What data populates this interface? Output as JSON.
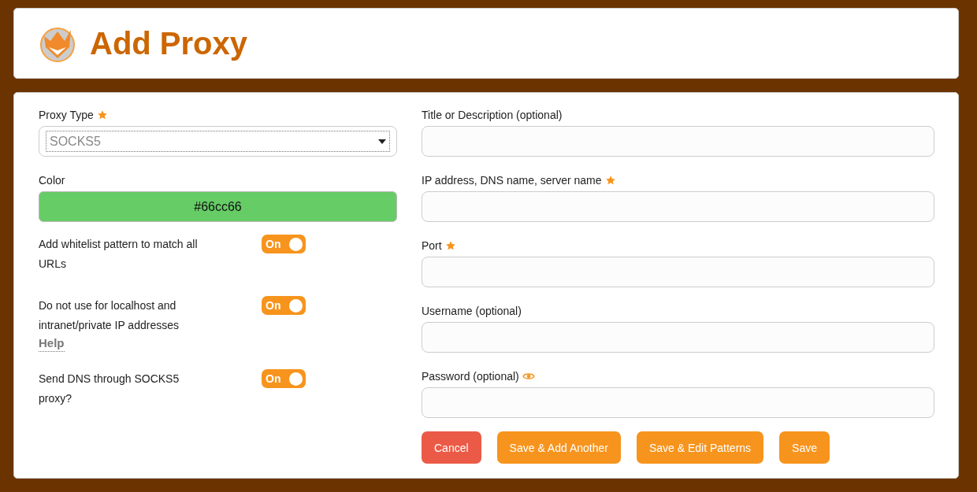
{
  "header": {
    "title": "Add Proxy"
  },
  "proxy_type": {
    "label": "Proxy Type",
    "required": true,
    "value": "SOCKS5"
  },
  "color": {
    "label": "Color",
    "value": "#66cc66",
    "color": "#66cc66"
  },
  "toggles": [
    {
      "label": "Add whitelist pattern to match all URLs",
      "on": true,
      "state_text": "On"
    },
    {
      "label": "Do not use for localhost and intranet/private IP addresses",
      "on": true,
      "state_text": "On",
      "help": "Help"
    },
    {
      "label": "Send DNS through SOCKS5 proxy?",
      "on": true,
      "state_text": "On"
    }
  ],
  "fields": [
    {
      "label": "Title or Description (optional)",
      "kind": "text",
      "required": false
    },
    {
      "label": "IP address, DNS name, server name",
      "kind": "text",
      "required": true
    },
    {
      "label": "Port",
      "kind": "text",
      "required": true
    },
    {
      "label": "Username (optional)",
      "kind": "text",
      "required": false
    },
    {
      "label": "Password (optional)",
      "kind": "password",
      "required": false
    }
  ],
  "buttons": [
    {
      "label": "Cancel",
      "kind": "danger"
    },
    {
      "label": "Save & Add Another",
      "kind": "primary"
    },
    {
      "label": "Save & Edit Patterns",
      "kind": "primary"
    },
    {
      "label": "Save",
      "kind": "primary"
    }
  ]
}
